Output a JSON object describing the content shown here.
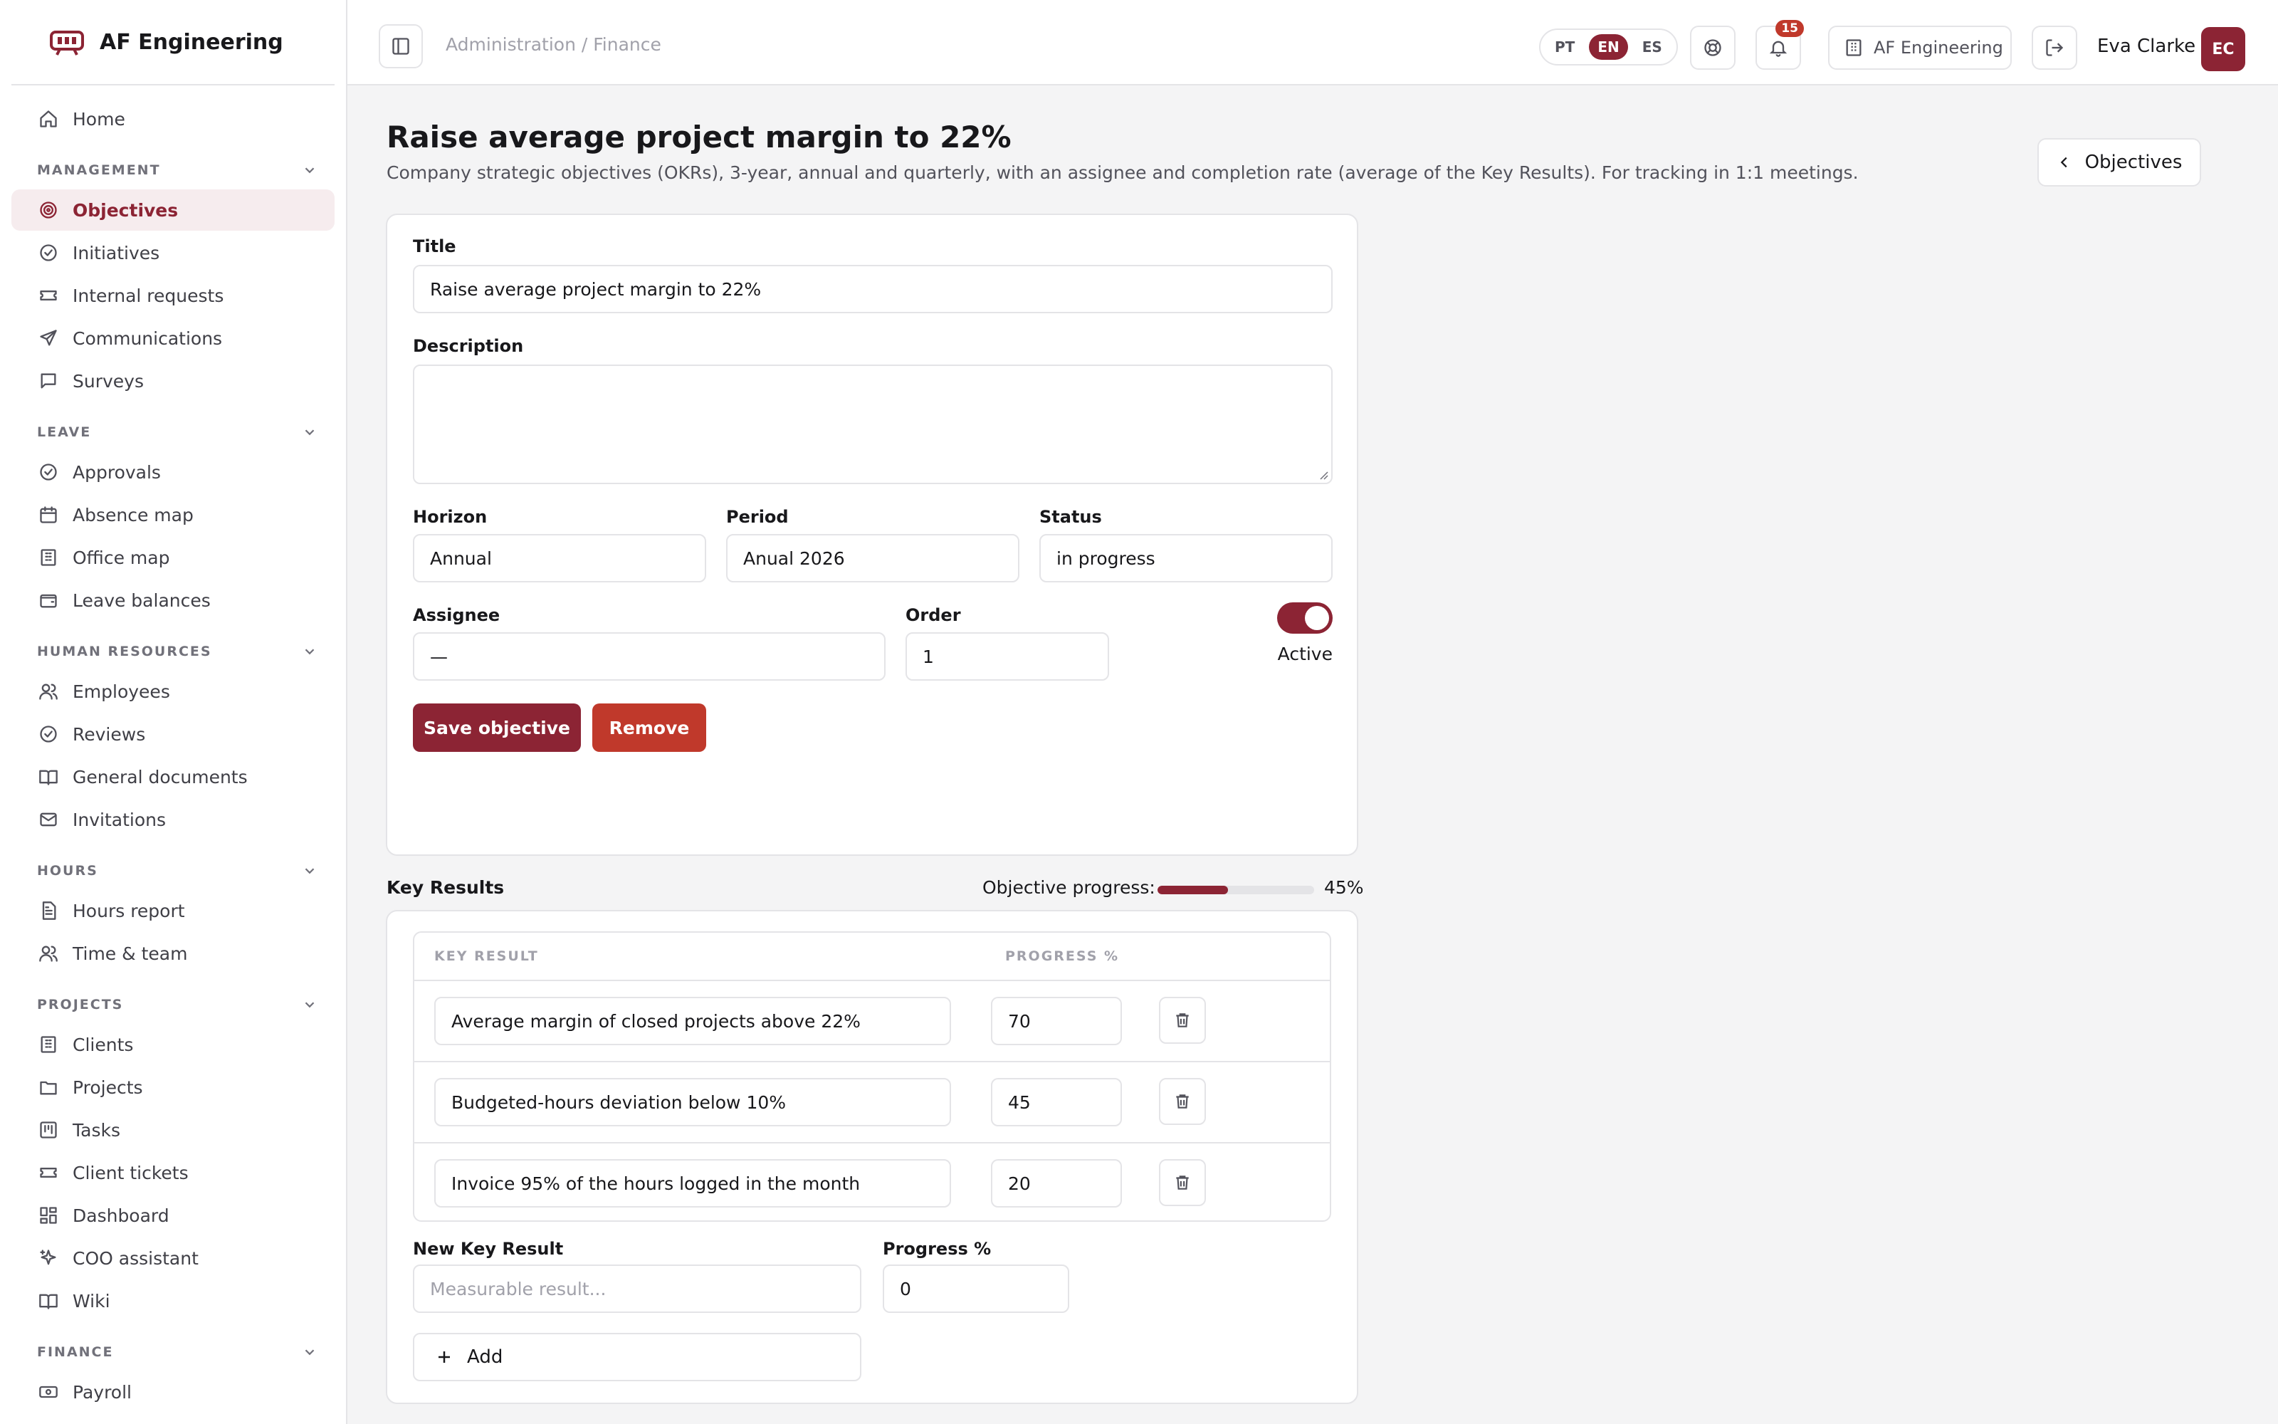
{
  "brand": {
    "name": "AF Engineering",
    "accent": "#8c2434"
  },
  "sidebar": {
    "top": [
      {
        "label": "Home",
        "icon": "home-icon"
      }
    ],
    "sections": [
      {
        "title": "MANAGEMENT",
        "items": [
          {
            "label": "Objectives",
            "icon": "target-icon",
            "active": true
          },
          {
            "label": "Initiatives",
            "icon": "check-circle-icon"
          },
          {
            "label": "Internal requests",
            "icon": "ticket-icon"
          },
          {
            "label": "Communications",
            "icon": "send-icon"
          },
          {
            "label": "Surveys",
            "icon": "message-square-icon"
          }
        ]
      },
      {
        "title": "LEAVE",
        "items": [
          {
            "label": "Approvals",
            "icon": "check-circle-icon"
          },
          {
            "label": "Absence map",
            "icon": "calendar-icon"
          },
          {
            "label": "Office map",
            "icon": "building-icon"
          },
          {
            "label": "Leave balances",
            "icon": "wallet-icon"
          }
        ]
      },
      {
        "title": "HUMAN RESOURCES",
        "items": [
          {
            "label": "Employees",
            "icon": "users-icon"
          },
          {
            "label": "Reviews",
            "icon": "check-circle-icon"
          },
          {
            "label": "General documents",
            "icon": "book-icon"
          },
          {
            "label": "Invitations",
            "icon": "mail-icon"
          }
        ]
      },
      {
        "title": "HOURS",
        "items": [
          {
            "label": "Hours report",
            "icon": "file-text-icon"
          },
          {
            "label": "Time & team",
            "icon": "users-icon"
          }
        ]
      },
      {
        "title": "PROJECTS",
        "items": [
          {
            "label": "Clients",
            "icon": "building-icon"
          },
          {
            "label": "Projects",
            "icon": "folder-icon"
          },
          {
            "label": "Tasks",
            "icon": "kanban-icon"
          },
          {
            "label": "Client tickets",
            "icon": "ticket-icon"
          },
          {
            "label": "Dashboard",
            "icon": "dashboard-icon"
          },
          {
            "label": "COO assistant",
            "icon": "sparkles-icon"
          },
          {
            "label": "Wiki",
            "icon": "book-icon"
          }
        ]
      },
      {
        "title": "FINANCE",
        "items": [
          {
            "label": "Payroll",
            "icon": "banknote-icon"
          }
        ]
      }
    ]
  },
  "topbar": {
    "breadcrumb": "Administration / Finance",
    "languages": [
      {
        "code": "PT"
      },
      {
        "code": "EN",
        "active": true
      },
      {
        "code": "ES"
      }
    ],
    "notifications_count": "15",
    "org_label": "AF Engineering",
    "user_name": "Eva Clarke",
    "user_initials": "EC"
  },
  "page": {
    "title": "Raise average project margin to 22%",
    "subtitle": "Company strategic objectives (OKRs), 3-year, annual and quarterly, with an assignee and completion rate (average of the Key Results). For tracking in 1:1 meetings.",
    "back_label": "Objectives"
  },
  "form": {
    "title_label": "Title",
    "title_value": "Raise average project margin to 22%",
    "description_label": "Description",
    "description_value": "",
    "horizon_label": "Horizon",
    "horizon_value": "Annual",
    "period_label": "Period",
    "period_value": "Anual 2026",
    "status_label": "Status",
    "status_value": "in progress",
    "assignee_label": "Assignee",
    "assignee_value": "—",
    "order_label": "Order",
    "order_value": "1",
    "active_label": "Active",
    "active": true,
    "save_label": "Save objective",
    "remove_label": "Remove"
  },
  "key_results": {
    "heading": "Key Results",
    "progress_label": "Objective progress:",
    "progress_value": 45,
    "progress_text": "45%",
    "columns": [
      "KEY RESULT",
      "PROGRESS %"
    ],
    "rows": [
      {
        "name": "Average margin of closed projects above 22%",
        "progress": "70"
      },
      {
        "name": "Budgeted-hours deviation below 10%",
        "progress": "45"
      },
      {
        "name": "Invoice 95% of the hours logged in the month",
        "progress": "20"
      }
    ],
    "new_label": "New Key Result",
    "new_placeholder": "Measurable result...",
    "new_progress_label": "Progress %",
    "new_progress_value": "0",
    "add_label": "Add"
  }
}
